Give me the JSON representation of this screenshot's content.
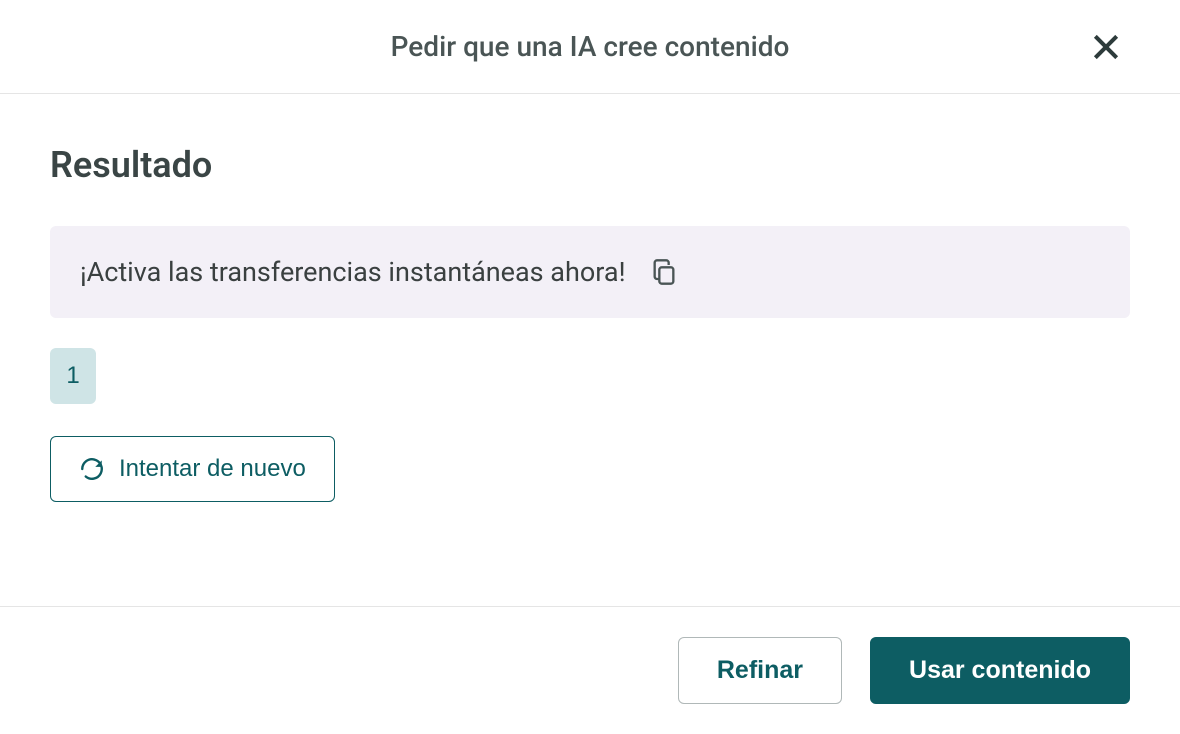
{
  "header": {
    "title": "Pedir que una IA cree contenido"
  },
  "body": {
    "heading": "Resultado",
    "result_text": "¡Activa las transferencias instantáneas ahora!",
    "pagination": {
      "current": "1"
    },
    "retry_label": "Intentar de nuevo"
  },
  "footer": {
    "refine_label": "Refinar",
    "use_label": "Usar contenido"
  }
}
